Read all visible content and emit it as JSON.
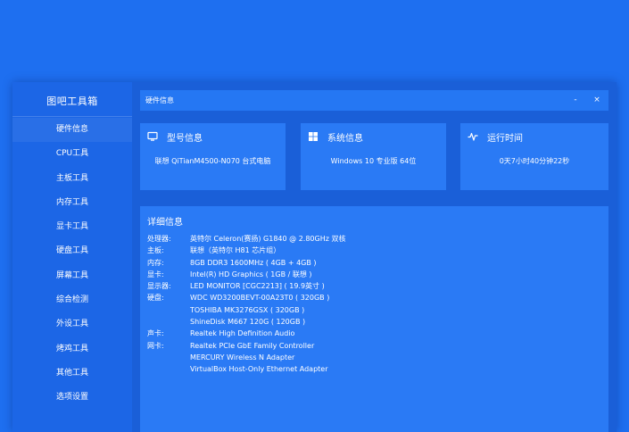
{
  "sidebar": {
    "title": "图吧工具箱",
    "items": [
      {
        "label": "硬件信息"
      },
      {
        "label": "CPU工具"
      },
      {
        "label": "主板工具"
      },
      {
        "label": "内存工具"
      },
      {
        "label": "显卡工具"
      },
      {
        "label": "硬盘工具"
      },
      {
        "label": "屏幕工具"
      },
      {
        "label": "综合检测"
      },
      {
        "label": "外设工具"
      },
      {
        "label": "烤鸡工具"
      },
      {
        "label": "其他工具"
      },
      {
        "label": "选项设置"
      }
    ]
  },
  "titlebar": {
    "title": "硬件信息",
    "minimize": "-",
    "close": "×"
  },
  "cards": {
    "model": {
      "title": "型号信息",
      "value": "联想 QiTianM4500-N070 台式电脑",
      "icon": "monitor-icon"
    },
    "system": {
      "title": "系统信息",
      "value": "Windows 10 专业版 64位",
      "icon": "windows-logo-icon"
    },
    "uptime": {
      "title": "运行时间",
      "value": "0天7小时40分钟22秒",
      "icon": "pulse-icon"
    }
  },
  "detail": {
    "title": "详细信息",
    "rows": [
      {
        "label": "处理器:",
        "value": "英特尔 Celeron(赛扬) G1840 @ 2.80GHz 双核"
      },
      {
        "label": "主板:",
        "value": "联想（英特尔 H81 芯片组）"
      },
      {
        "label": "内存:",
        "value": "8GB DDR3 1600MHz ( 4GB + 4GB )"
      },
      {
        "label": "显卡:",
        "value": "Intel(R) HD Graphics ( 1GB / 联想 )"
      },
      {
        "label": "显示器:",
        "value": "LED MONITOR [CGC2213] ( 19.9英寸 )"
      },
      {
        "label": "硬盘:",
        "value": "WDC WD3200BEVT-00A23T0 ( 320GB )"
      },
      {
        "label": "",
        "value": "TOSHIBA MK3276GSX ( 320GB )"
      },
      {
        "label": "",
        "value": "ShineDisk M667 120G ( 120GB )"
      },
      {
        "label": "声卡:",
        "value": "Realtek High Definition Audio"
      },
      {
        "label": "网卡:",
        "value": "Realtek PCIe GbE Family Controller"
      },
      {
        "label": "",
        "value": "MERCURY Wireless N Adapter"
      },
      {
        "label": "",
        "value": "VirtualBox Host-Only Ethernet Adapter"
      }
    ]
  },
  "colors": {
    "background": "#1e6ff0",
    "window": "#1a5fd8",
    "sidebar": "#1c66e6",
    "panel": "#2a7af5",
    "text": "#ffffff"
  }
}
